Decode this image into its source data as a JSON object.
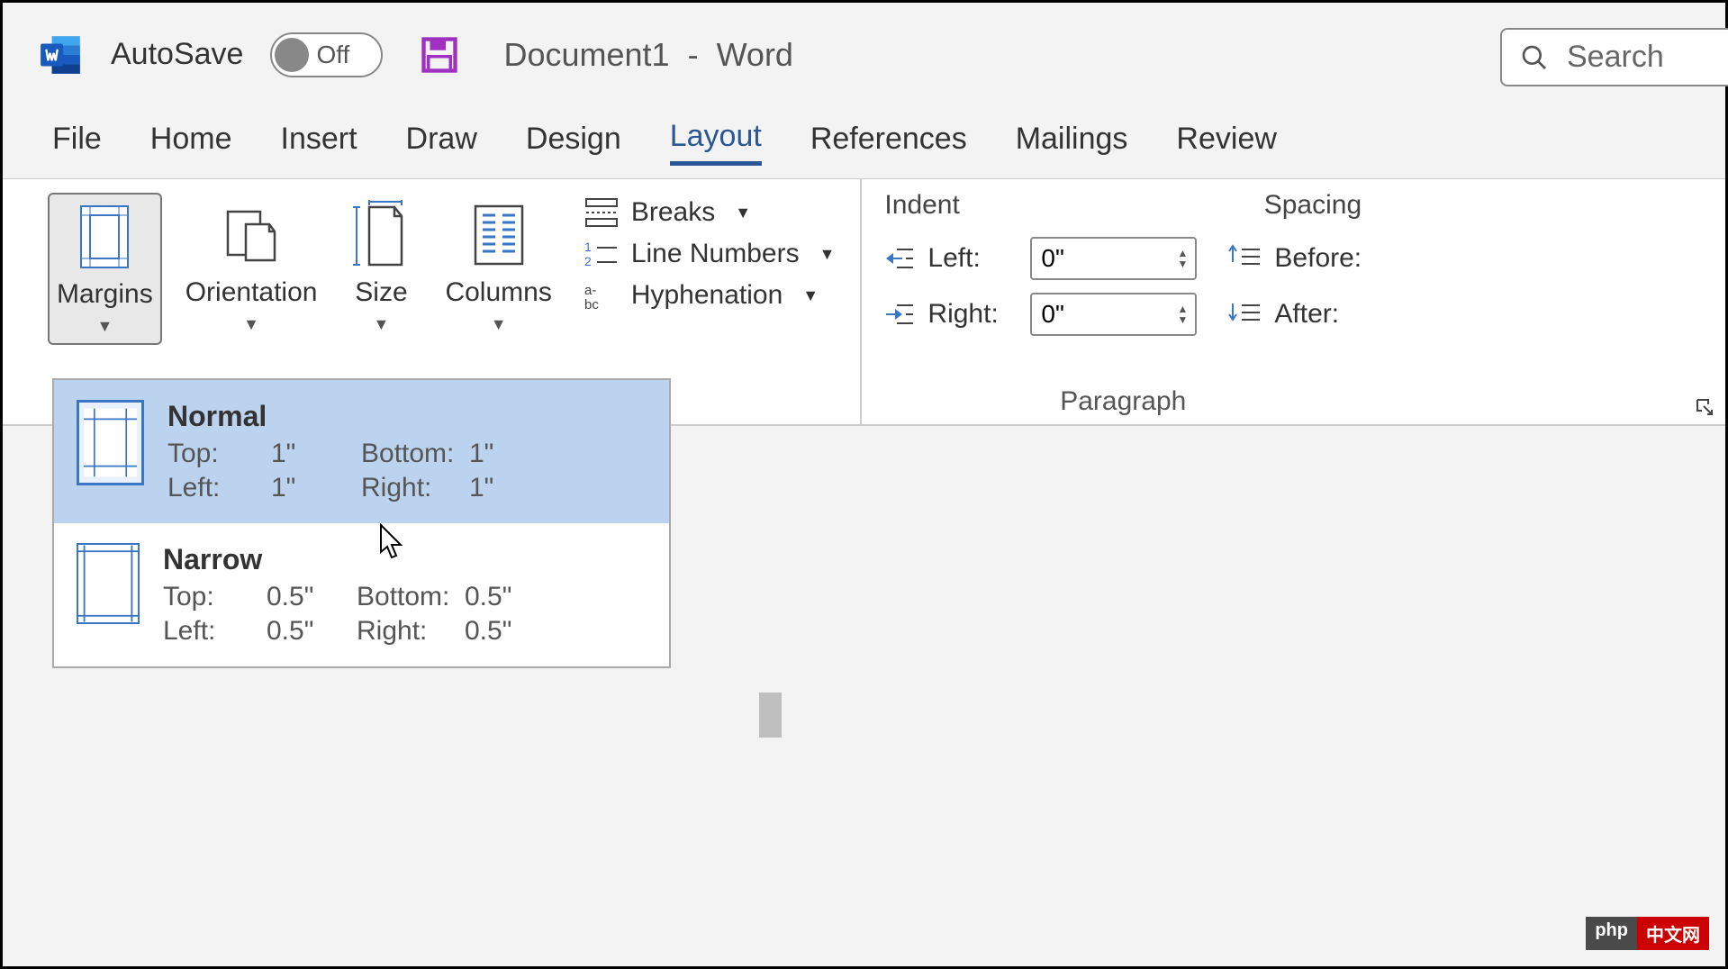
{
  "titlebar": {
    "autosave_label": "AutoSave",
    "toggle_state": "Off",
    "doc_name": "Document1",
    "separator": "-",
    "app_name": "Word",
    "search_placeholder": "Search"
  },
  "tabs": {
    "items": [
      "File",
      "Home",
      "Insert",
      "Draw",
      "Design",
      "Layout",
      "References",
      "Mailings",
      "Review"
    ],
    "active_index": 5
  },
  "ribbon": {
    "page_setup": {
      "margins": "Margins",
      "orientation": "Orientation",
      "size": "Size",
      "columns": "Columns",
      "breaks": "Breaks",
      "line_numbers": "Line Numbers",
      "hyphenation": "Hyphenation"
    },
    "paragraph": {
      "indent_header": "Indent",
      "spacing_header": "Spacing",
      "left_label": "Left:",
      "right_label": "Right:",
      "before_label": "Before:",
      "after_label": "After:",
      "left_value": "0\"",
      "right_value": "0\"",
      "group_label": "Paragraph"
    }
  },
  "margins_dropdown": {
    "items": [
      {
        "name": "Normal",
        "top_label": "Top:",
        "top": "1\"",
        "bottom_label": "Bottom:",
        "bottom": "1\"",
        "left_label": "Left:",
        "left": "1\"",
        "right_label": "Right:",
        "right": "1\"",
        "hover": true
      },
      {
        "name": "Narrow",
        "top_label": "Top:",
        "top": "0.5\"",
        "bottom_label": "Bottom:",
        "bottom": "0.5\"",
        "left_label": "Left:",
        "left": "0.5\"",
        "right_label": "Right:",
        "right": "0.5\"",
        "hover": false
      }
    ]
  },
  "badge": {
    "left": "php",
    "right": "中文网"
  }
}
